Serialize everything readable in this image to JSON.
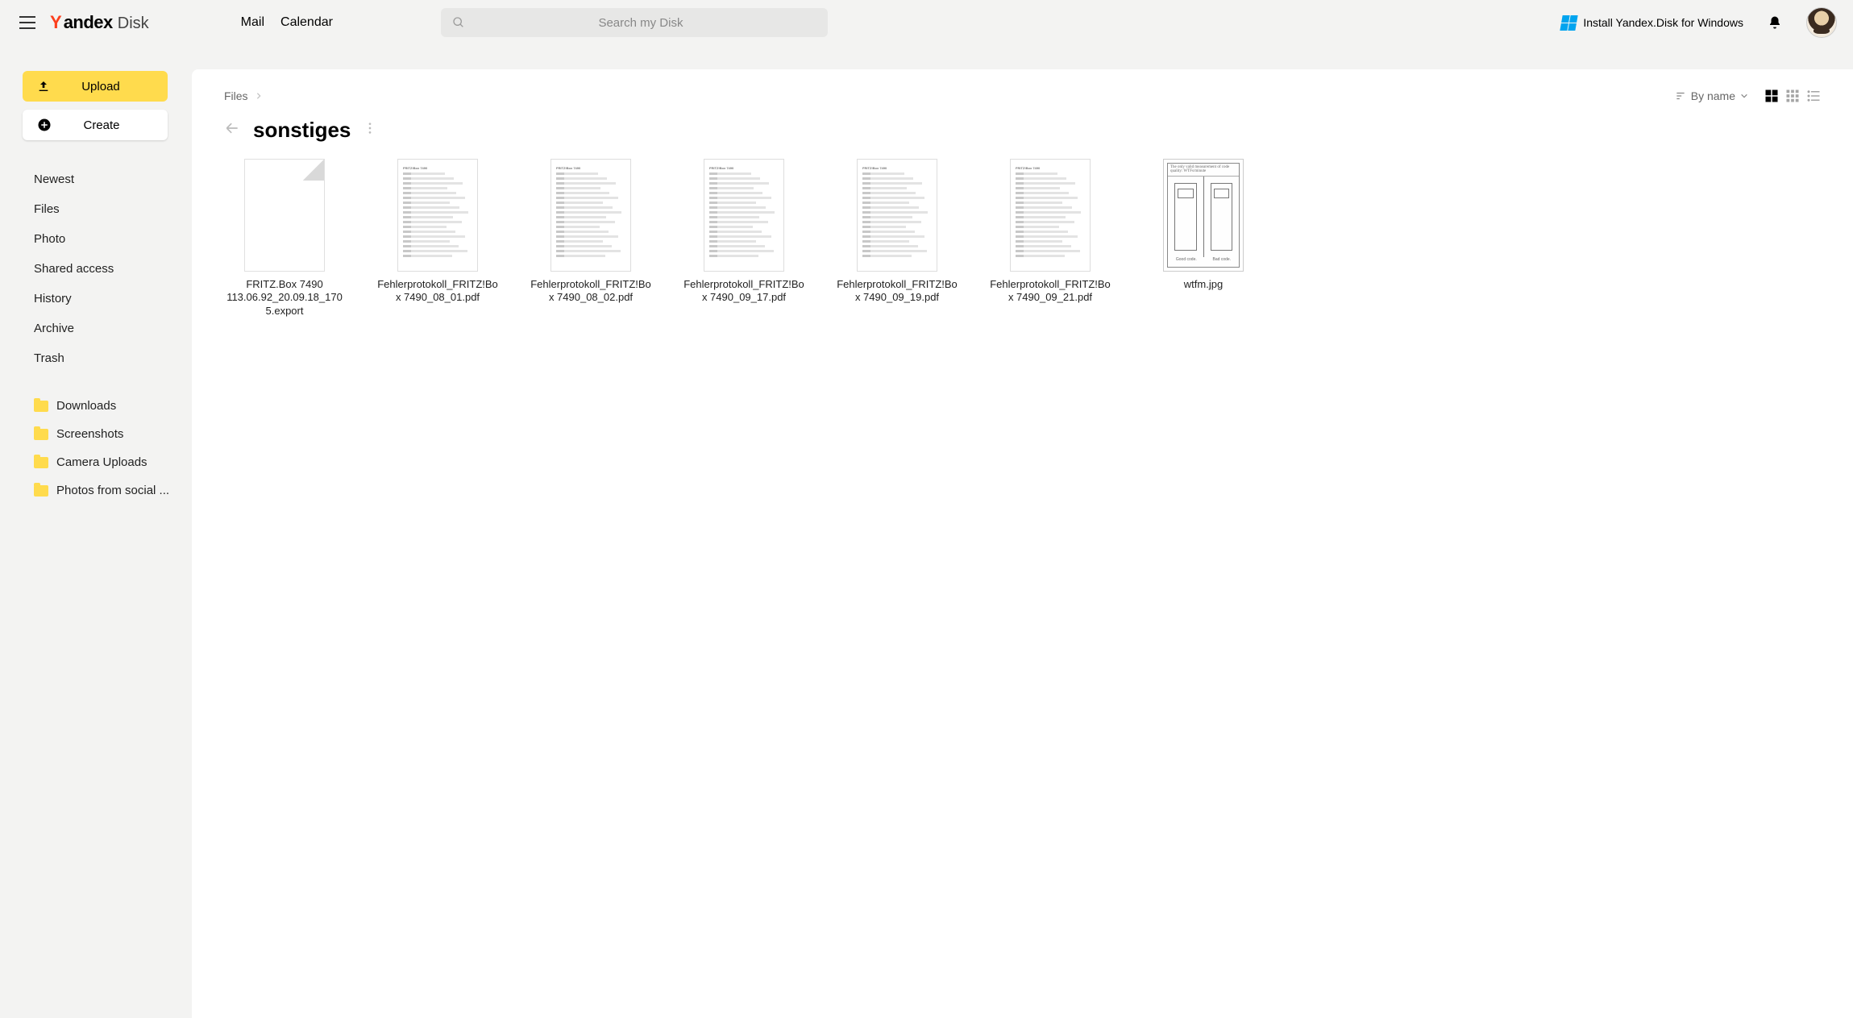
{
  "header": {
    "logo_brand_y": "Y",
    "logo_brand_rest": "andex",
    "logo_product": "Disk",
    "links": [
      "Mail",
      "Calendar"
    ],
    "search_placeholder": "Search my Disk",
    "install_label": "Install Yandex.Disk for Windows"
  },
  "sidebar": {
    "upload_label": "Upload",
    "create_label": "Create",
    "nav": [
      "Newest",
      "Files",
      "Photo",
      "Shared access",
      "History",
      "Archive",
      "Trash"
    ],
    "folders": [
      "Downloads",
      "Screenshots",
      "Camera Uploads",
      "Photos from social ..."
    ]
  },
  "main": {
    "breadcrumb_root": "Files",
    "folder_title": "sonstiges",
    "sort_label": "By name",
    "files": [
      {
        "name": "FRITZ.Box 7490 113.06.92_20.09.18_1705.export",
        "type": "export"
      },
      {
        "name": "Fehlerprotokoll_FRITZ!Box 7490_08_01.pdf",
        "type": "pdf"
      },
      {
        "name": "Fehlerprotokoll_FRITZ!Box 7490_08_02.pdf",
        "type": "pdf"
      },
      {
        "name": "Fehlerprotokoll_FRITZ!Box 7490_09_17.pdf",
        "type": "pdf"
      },
      {
        "name": "Fehlerprotokoll_FRITZ!Box 7490_09_19.pdf",
        "type": "pdf"
      },
      {
        "name": "Fehlerprotokoll_FRITZ!Box 7490_09_21.pdf",
        "type": "pdf"
      },
      {
        "name": "wtfm.jpg",
        "type": "image"
      }
    ]
  }
}
